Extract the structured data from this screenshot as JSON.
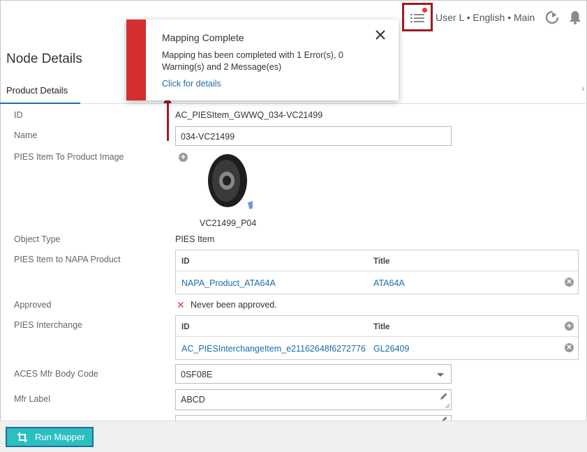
{
  "header": {
    "user_info": "User L • English • Main",
    "icons": [
      "tasks-icon",
      "refresh-icon",
      "bell-icon"
    ]
  },
  "page": {
    "title": "Node Details",
    "tabs": [
      {
        "label": "Product Details",
        "active": true
      }
    ]
  },
  "fields": {
    "id": {
      "label": "ID",
      "value": "AC_PIESItem_GWWQ_034-VC21499"
    },
    "name": {
      "label": "Name",
      "value": "034-VC21499"
    },
    "image": {
      "label": "PIES Item To Product Image",
      "caption": "VC21499_P04"
    },
    "object_type": {
      "label": "Object Type",
      "value": "PIES Item"
    },
    "napa_product": {
      "label": "PIES Item to NAPA Product",
      "columns": [
        "ID",
        "Title"
      ],
      "rows": [
        {
          "id": "NAPA_Product_ATA64A",
          "title": "ATA64A"
        }
      ]
    },
    "approved": {
      "label": "Approved",
      "value": "Never been approved."
    },
    "interchange": {
      "label": "PIES Interchange",
      "columns": [
        "ID",
        "Title"
      ],
      "rows": [
        {
          "id": "AC_PIESInterchangeItem_e21162648f6272776",
          "title": "GL26409"
        }
      ]
    },
    "aces_body_code": {
      "label": "ACES Mfr Body Code",
      "value": "0SF08E"
    },
    "mfr_label": {
      "label": "Mfr Label",
      "value": "ABCD"
    }
  },
  "toast": {
    "title": "Mapping Complete",
    "message": "Mapping has been completed with 1 Error(s), 0 Warning(s) and 2 Message(es)",
    "link": "Click for details",
    "accent": "#d32f2f"
  },
  "footer": {
    "run_button": "Run Mapper"
  },
  "colors": {
    "link": "#1a6ea8",
    "highlight": "#9b1c24",
    "run_button_bg": "#2bbfc0"
  }
}
